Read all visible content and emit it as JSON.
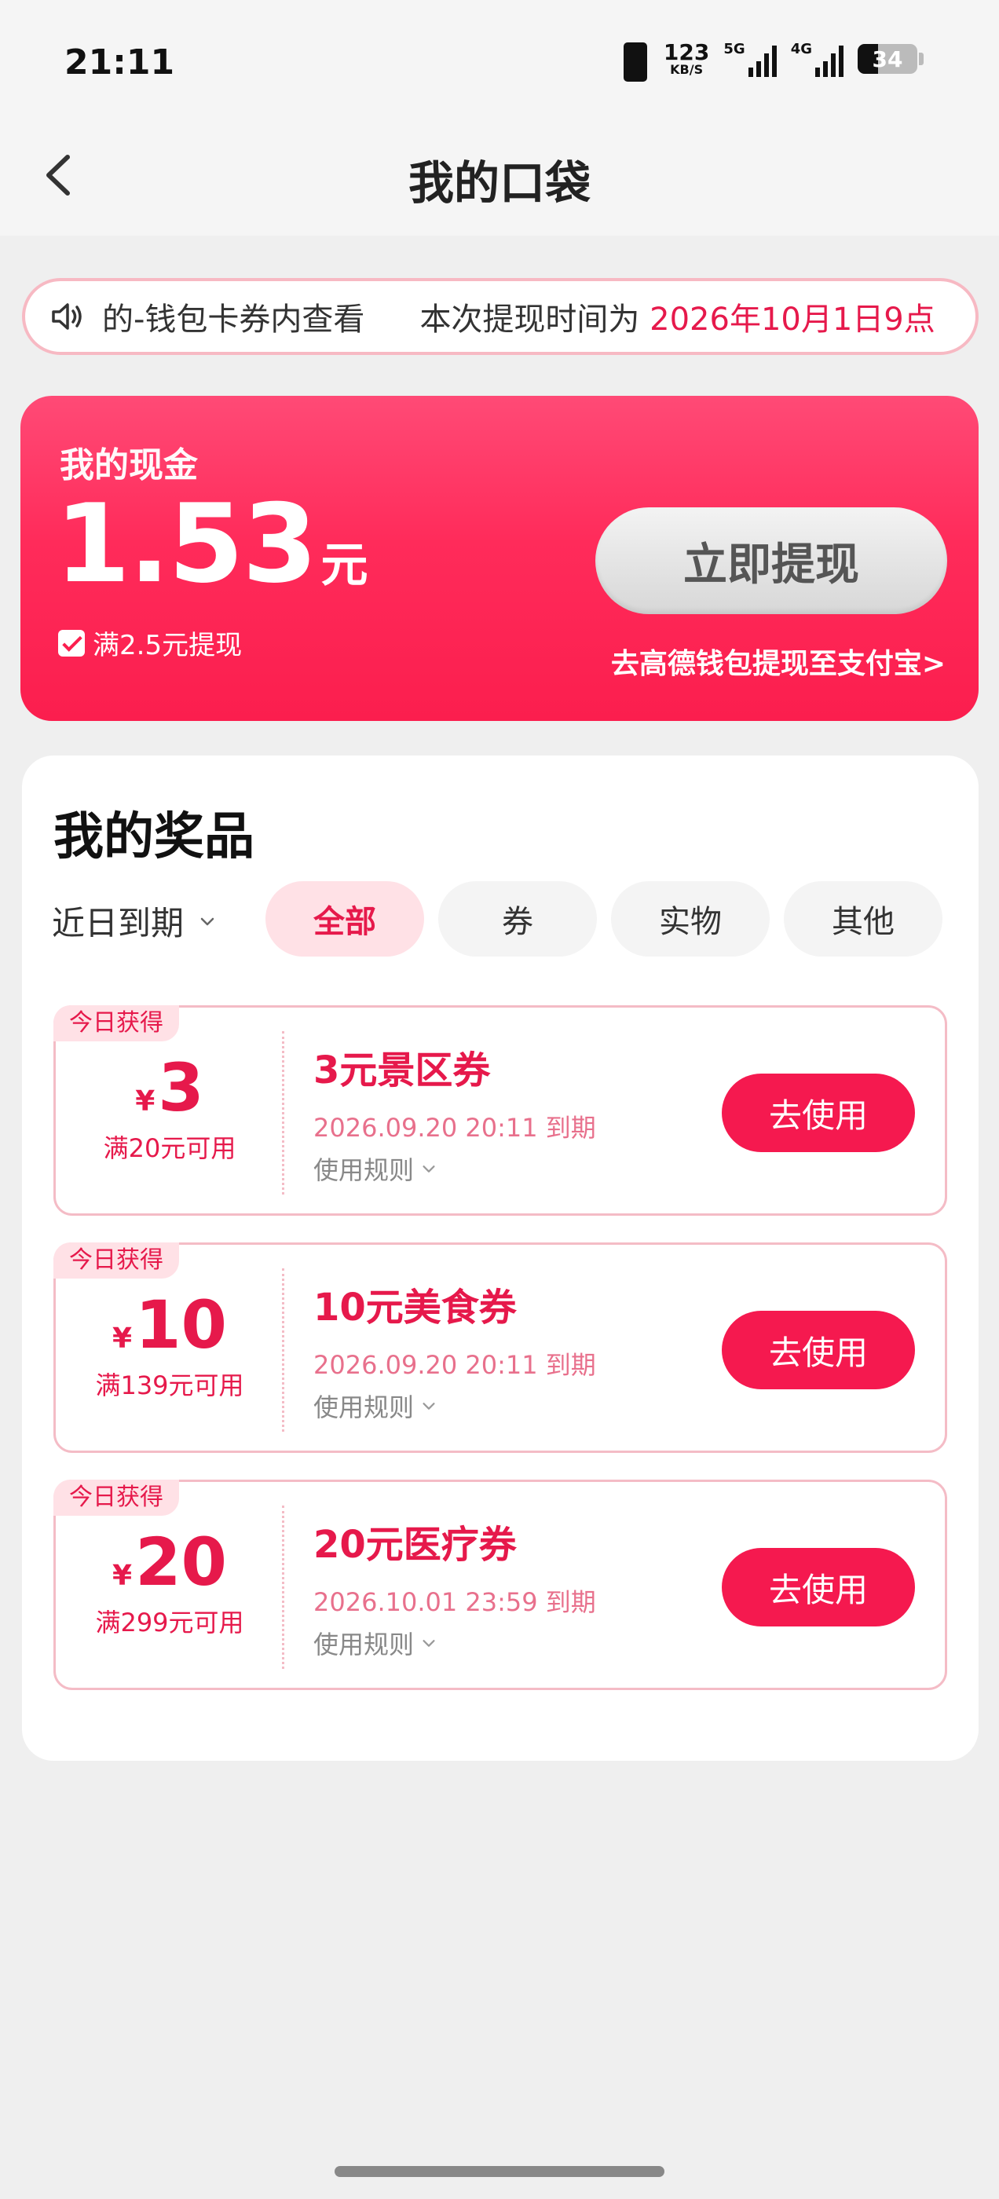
{
  "status_bar": {
    "time": "21:11",
    "speed_value": "123",
    "speed_unit": "KB/S",
    "net1": "5G",
    "net2": "4G",
    "battery": "34",
    "battery_level": 0.34
  },
  "nav": {
    "title": "我的口袋"
  },
  "notice": {
    "text_start": "的-钱包卡券内查看",
    "text_mid": "本次提现时间为 ",
    "text_highlight": "2026年10月1日9点"
  },
  "cash": {
    "label": "我的现金",
    "amount": "1.53",
    "unit": "元",
    "condition": "满2.5元提现",
    "withdraw_button": "立即提现",
    "alt_link": "去高德钱包提现至支付宝>"
  },
  "prizes": {
    "title": "我的奖品",
    "sort_label": "近日到期",
    "tabs": [
      {
        "label": "全部",
        "active": true
      },
      {
        "label": "券",
        "active": false
      },
      {
        "label": "实物",
        "active": false
      },
      {
        "label": "其他",
        "active": false
      }
    ],
    "coupons": [
      {
        "badge": "今日获得",
        "currency": "¥",
        "value": "3",
        "min_spend": "满20元可用",
        "name": "3元景区券",
        "expiry": "2026.09.20 20:11 到期",
        "rule": "使用规则",
        "button": "去使用"
      },
      {
        "badge": "今日获得",
        "currency": "¥",
        "value": "10",
        "min_spend": "满139元可用",
        "name": "10元美食券",
        "expiry": "2026.09.20 20:11 到期",
        "rule": "使用规则",
        "button": "去使用"
      },
      {
        "badge": "今日获得",
        "currency": "¥",
        "value": "20",
        "min_spend": "满299元可用",
        "name": "20元医疗券",
        "expiry": "2026.10.01 23:59 到期",
        "rule": "使用规则",
        "button": "去使用"
      }
    ]
  },
  "colors": {
    "accent": "#f5194f",
    "accent_text": "#e6194b",
    "border": "#f4bcc6",
    "background": "#efefef"
  }
}
